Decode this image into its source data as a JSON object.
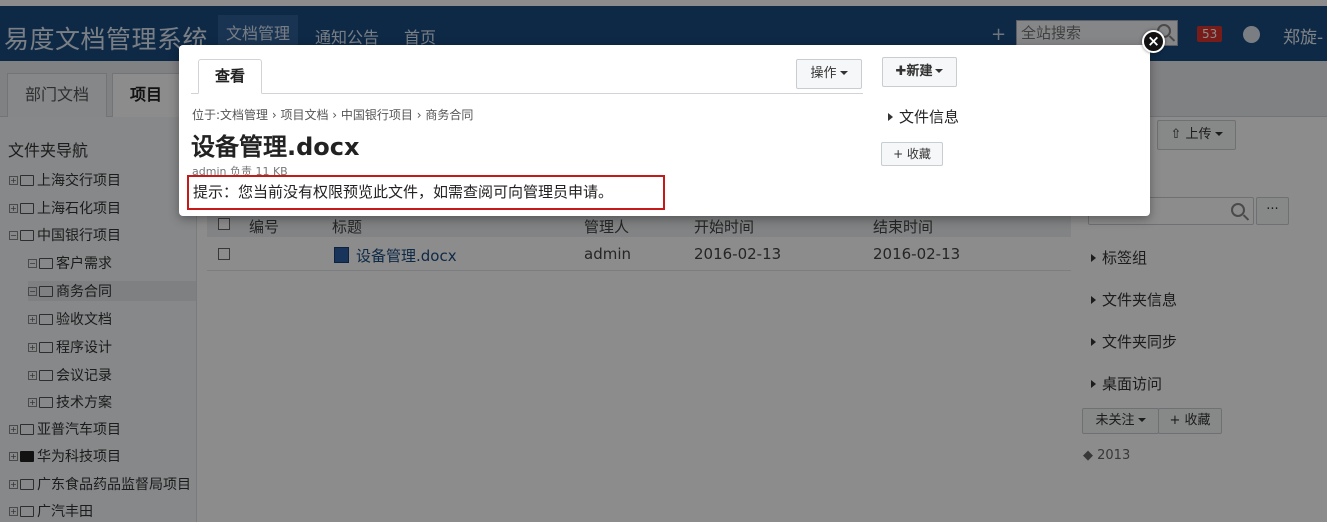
{
  "header": {
    "brand": "易度文档管理系统",
    "nav": [
      "文档管理",
      "通知公告",
      "首页"
    ],
    "plus": "+",
    "search_placeholder": "全站搜索",
    "badge_count": "53",
    "user": "郑旋-"
  },
  "tabs": [
    "部门文档",
    "项目文档"
  ],
  "sidebar": {
    "title": "文件夹导航",
    "items": [
      {
        "label": "上海交行项目",
        "exp": "+"
      },
      {
        "label": "上海石化项目",
        "exp": "+"
      },
      {
        "label": "中国银行项目",
        "exp": "−"
      },
      {
        "label": "客户需求",
        "exp": "−"
      },
      {
        "label": "商务合同",
        "exp": "−"
      },
      {
        "label": "验收文档",
        "exp": "+"
      },
      {
        "label": "程序设计",
        "exp": "+"
      },
      {
        "label": "会议记录",
        "exp": "+"
      },
      {
        "label": "技术方案",
        "exp": "+"
      },
      {
        "label": "亚普汽车项目",
        "exp": "+"
      },
      {
        "label": "华为科技项目",
        "exp": "+"
      },
      {
        "label": "广东食品药品监督局项目",
        "exp": "+"
      },
      {
        "label": "广汽丰田",
        "exp": "+"
      }
    ]
  },
  "table": {
    "headers": [
      "编号",
      "标题",
      "管理人",
      "开始时间",
      "结束时间"
    ],
    "rows": [
      {
        "title": "设备管理.docx",
        "manager": "admin",
        "start": "2016-02-13",
        "end": "2016-02-13"
      }
    ]
  },
  "right": {
    "upload": "上传",
    "more": "···",
    "links": [
      "标签组",
      "文件夹信息",
      "文件夹同步",
      "桌面访问"
    ],
    "follow": "未关注",
    "fav": "+ 收藏",
    "tag": "2013"
  },
  "modal": {
    "tab": "查看",
    "ops": "操作",
    "new": "新建",
    "breadcrumb": "位于:文档管理 › 项目文档 › 中国银行项目 › 商务合同",
    "title": "设备管理.docx",
    "meta": "admin 负责    11 KB",
    "warning": "提示：您当前没有权限预览此文件，如需查阅可向管理员申请。",
    "file_info": "文件信息",
    "fav": "+ 收藏",
    "close": "×"
  }
}
